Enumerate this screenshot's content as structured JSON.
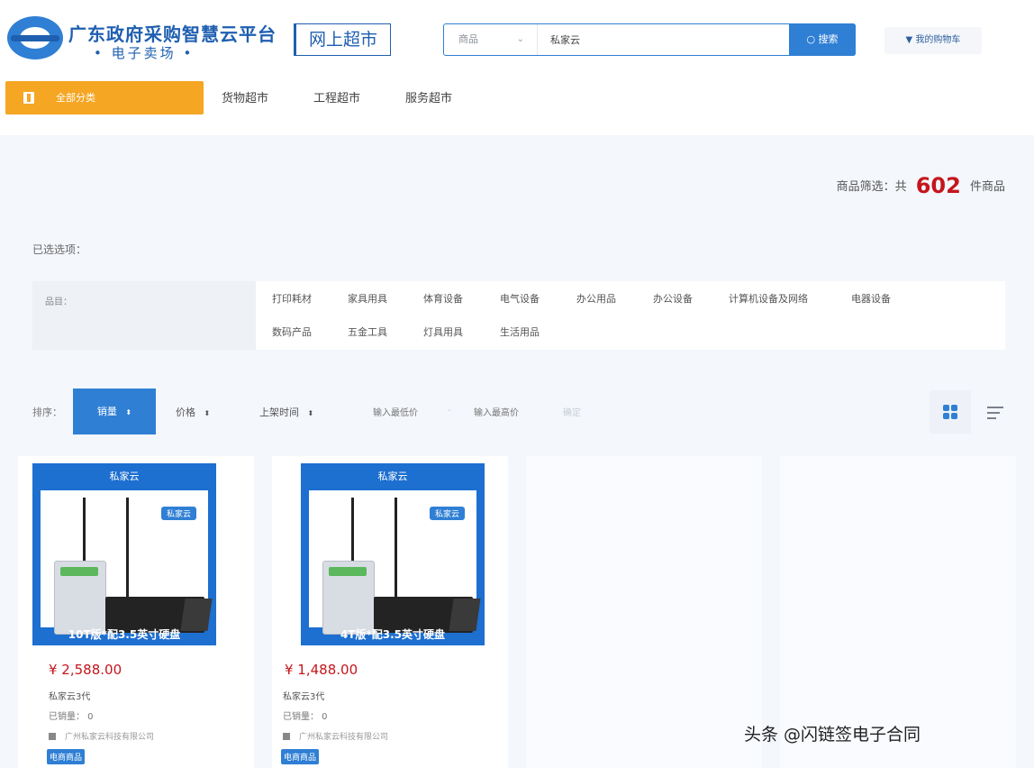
{
  "header": {
    "logo_title": "广东政府采购智慧云平台",
    "logo_subtitle": "电子卖场",
    "market_name": "网上超市",
    "search": {
      "scope": "商品",
      "query": "私家云",
      "button": "搜索"
    },
    "cart": "我的购物车"
  },
  "nav": {
    "all_categories": "全部分类",
    "links": [
      "货物超市",
      "工程超市",
      "服务超市"
    ]
  },
  "summary": {
    "prefix": "商品筛选：共",
    "count": "602",
    "suffix": "件商品"
  },
  "selected_label": "已选选项：",
  "filter": {
    "label": "品目：",
    "options": [
      "打印耗材",
      "家具用具",
      "体育设备",
      "电气设备",
      "办公用品",
      "办公设备",
      "计算机设备及网络",
      "电器设备",
      "数码产品",
      "五金工具",
      "灯具用具",
      "生活用品"
    ]
  },
  "sort": {
    "label": "排序：",
    "options": [
      "销量",
      "价格",
      "上架时间"
    ],
    "price_min_placeholder": "输入最低价",
    "price_sep": "-",
    "price_max_placeholder": "输入最高价",
    "confirm": "确定"
  },
  "products": [
    {
      "brand": "私家云",
      "badge": "私家云",
      "caption": "10T版*配3.5英寸硬盘",
      "price": "¥ 2,588.00",
      "name": "私家云3代",
      "sales": "已销量：   0",
      "shop": "广州私家云科技有限公司",
      "tag": "电商商品"
    },
    {
      "brand": "私家云",
      "badge": "私家云",
      "caption": "4T版*配3.5英寸硬盘",
      "price": "¥ 1,488.00",
      "name": "私家云3代",
      "sales": "已销量：   0",
      "shop": "广州私家云科技有限公司",
      "tag": "电商商品"
    }
  ],
  "watermark": "头条 @闪链签电子合同",
  "colors": {
    "primary": "#2f7fd4",
    "accent": "#f5a623",
    "price": "#c4161c",
    "brand": "#1f5fb0"
  }
}
